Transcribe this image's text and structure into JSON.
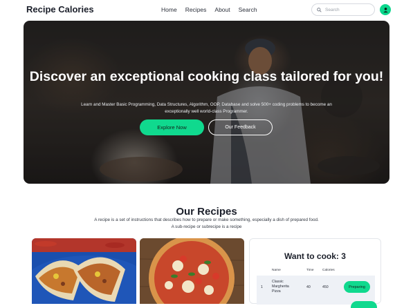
{
  "header": {
    "logo": "Recipe Calories",
    "nav": [
      "Home",
      "Recipes",
      "About",
      "Search"
    ],
    "search_placeholder": "Search"
  },
  "hero": {
    "title": "Discover an exceptional cooking class tailored for you!",
    "subtitle": "Learn and Master Basic Programming, Data Structures, Algorithm, OOP, Database and solve 500+ coding problems to become an exceptionally well world-class Programmer.",
    "primary_button": "Explore Now",
    "secondary_button": "Our Feedback"
  },
  "recipes": {
    "title": "Our Recipes",
    "description_line1": "A recipe is a set of instructions that describes how to prepare or make something, especially a dish of prepared food.",
    "description_line2": "A sub-recipe or subrecipe is a recipe"
  },
  "want_to_cook": {
    "title": "Want to cook: 3",
    "columns": [
      "Name",
      "Time",
      "Calories"
    ],
    "rows": [
      {
        "index": "1",
        "name_line1": "Classic",
        "name_line2": "Margherita",
        "name_line3": "Pizza",
        "time": "40",
        "calories": "450",
        "status": "Preparing"
      }
    ]
  },
  "colors": {
    "accent": "#10d98e",
    "text_dark": "#1b1f2a"
  },
  "icons": [
    "search-icon",
    "user-icon"
  ]
}
